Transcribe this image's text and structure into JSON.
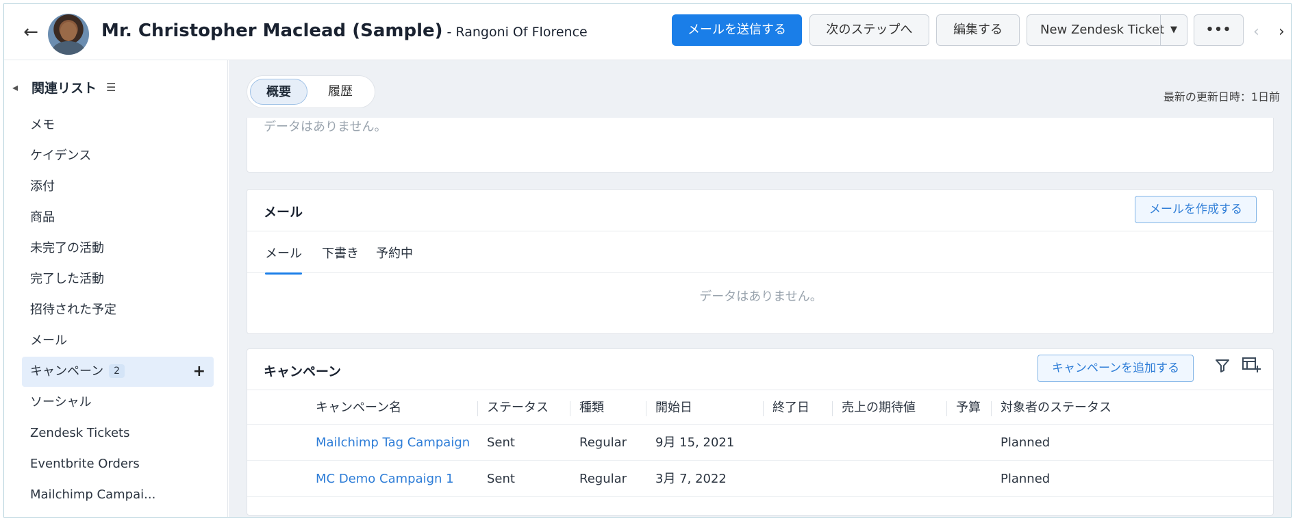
{
  "header": {
    "back_icon": "arrow-left-icon",
    "contact_name": "Mr. Christopher Maclead (Sample)",
    "account": "- Rangoni Of Florence",
    "send_email": "メールを送信する",
    "next_step": "次のステップへ",
    "edit": "編集する",
    "zendesk": "New Zendesk Ticket",
    "more": "•••",
    "prev_arrow": "‹",
    "next_arrow": "›"
  },
  "sidebar": {
    "title": "関連リスト",
    "items": [
      {
        "label": "メモ"
      },
      {
        "label": "ケイデンス"
      },
      {
        "label": "添付"
      },
      {
        "label": "商品"
      },
      {
        "label": "未完了の活動"
      },
      {
        "label": "完了した活動"
      },
      {
        "label": "招待された予定"
      },
      {
        "label": "メール"
      },
      {
        "label": "キャンペーン",
        "badge": "2",
        "active": true
      },
      {
        "label": "ソーシャル"
      },
      {
        "label": "Zendesk Tickets"
      },
      {
        "label": "Eventbrite Orders"
      },
      {
        "label": "Mailchimp Campai..."
      }
    ]
  },
  "toolbar": {
    "tab_overview": "概要",
    "tab_history": "履歴",
    "last_updated": "最新の更新日時：1日前"
  },
  "top_card": {
    "empty": "データはありません。"
  },
  "mail_section": {
    "title": "メール",
    "compose": "メールを作成する",
    "tabs": [
      "メール",
      "下書き",
      "予約中"
    ],
    "empty": "データはありません。"
  },
  "campaign_section": {
    "title": "キャンペーン",
    "add": "キャンペーンを追加する",
    "columns": [
      "キャンペーン名",
      "ステータス",
      "種類",
      "開始日",
      "終了日",
      "売上の期待値",
      "予算",
      "対象者のステータス"
    ],
    "rows": [
      {
        "name": "Mailchimp Tag Campaign",
        "status": "Sent",
        "type": "Regular",
        "start": "9月 15, 2021",
        "end": "",
        "expected": "",
        "budget": "",
        "member_status": "Planned"
      },
      {
        "name": "MC Demo Campaign 1",
        "status": "Sent",
        "type": "Regular",
        "start": "3月 7, 2022",
        "end": "",
        "expected": "",
        "budget": "",
        "member_status": "Planned"
      }
    ]
  },
  "colors": {
    "primary": "#1a7ee8",
    "link": "#2e7dd7",
    "active_bg": "#e4eefb"
  }
}
